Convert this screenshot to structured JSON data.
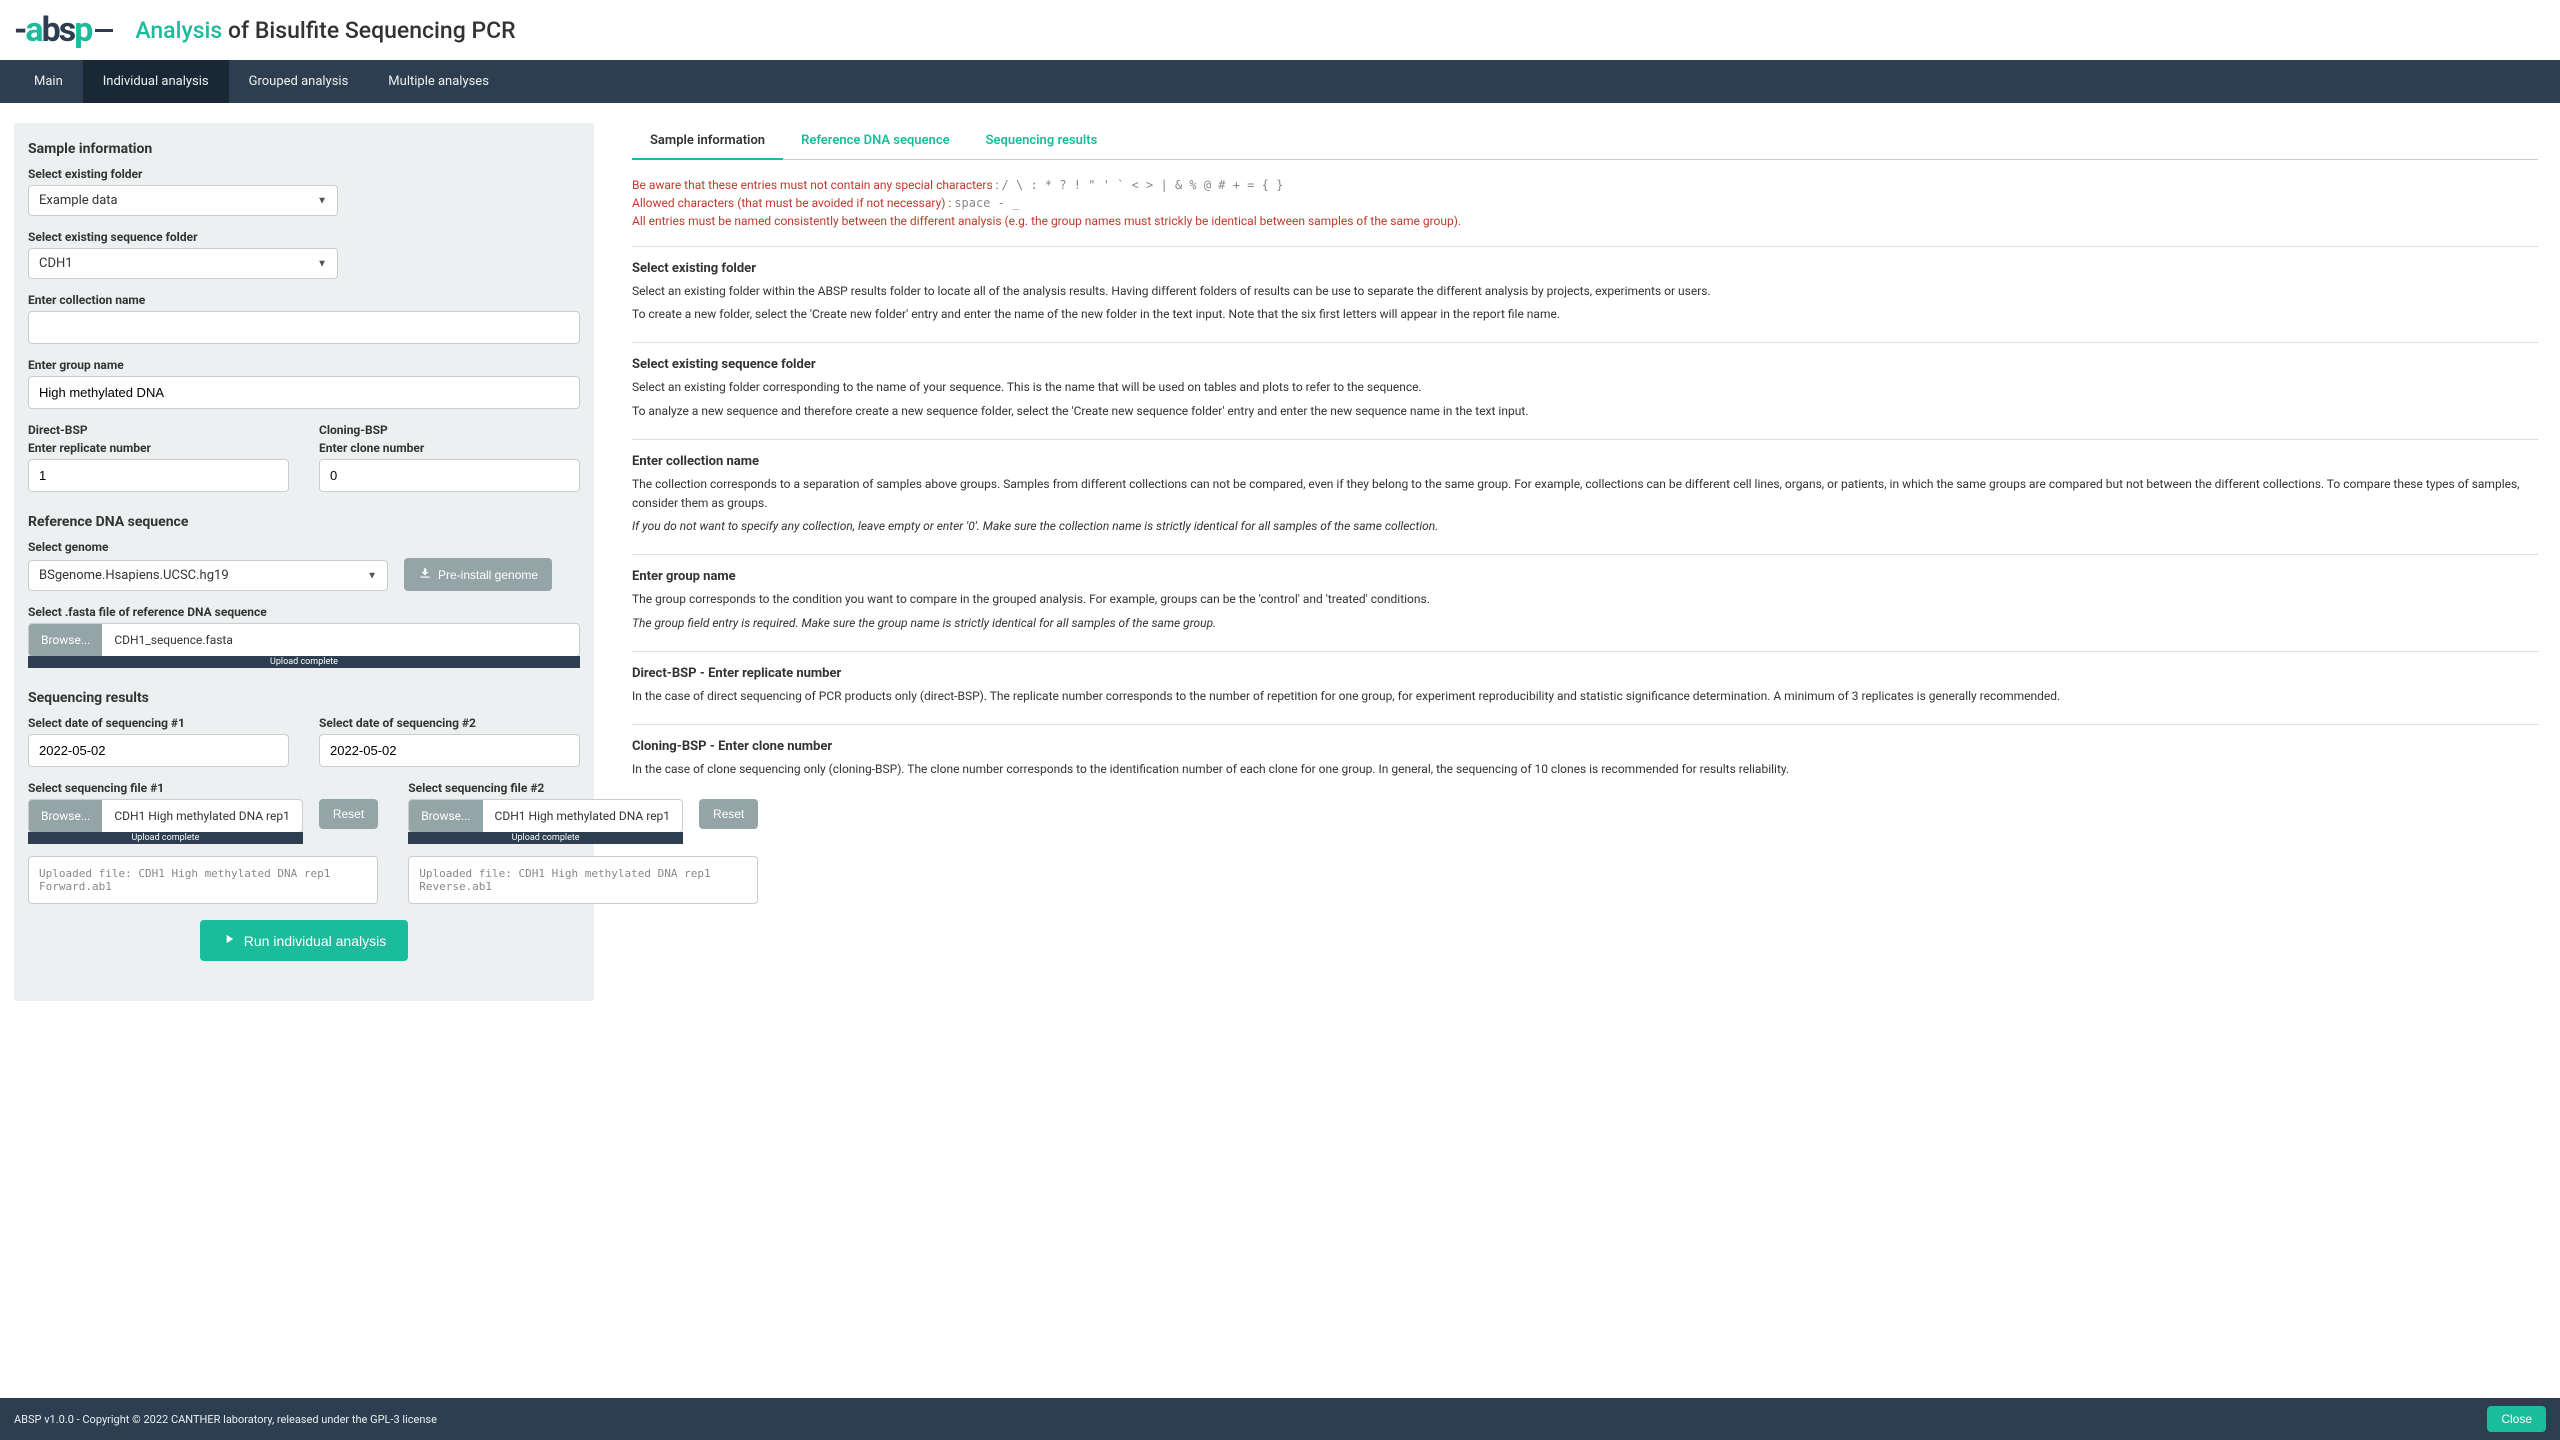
{
  "header": {
    "logo_plain_before": "-",
    "logo_accent1": "a",
    "logo_mid": "bs",
    "logo_accent2": "p",
    "title_accent": "Analysis",
    "title_rest": " of Bisulfite Sequencing PCR"
  },
  "nav": {
    "main": "Main",
    "individual": "Individual analysis",
    "grouped": "Grouped analysis",
    "multiple": "Multiple analyses"
  },
  "left": {
    "sample_info_title": "Sample information",
    "select_folder_label": "Select existing folder",
    "select_folder_value": "Example data",
    "select_seqfolder_label": "Select existing sequence folder",
    "select_seqfolder_value": "CDH1",
    "collection_label": "Enter collection name",
    "collection_value": "",
    "group_label": "Enter group name",
    "group_value": "High methylated DNA",
    "direct_bsp_label": "Direct-BSP",
    "replicate_label": "Enter replicate number",
    "replicate_value": "1",
    "cloning_bsp_label": "Cloning-BSP",
    "clone_label": "Enter clone number",
    "clone_value": "0",
    "ref_section_title": "Reference DNA sequence",
    "genome_label": "Select genome",
    "genome_value": "BSgenome.Hsapiens.UCSC.hg19",
    "preinstall_btn": "Pre-install genome",
    "fasta_label": "Select .fasta file of reference DNA sequence",
    "browse_label": "Browse...",
    "fasta_filename": "CDH1_sequence.fasta",
    "upload_complete": "Upload complete",
    "seq_results_title": "Sequencing results",
    "date1_label": "Select date of sequencing #1",
    "date1_value": "2022-05-02",
    "date2_label": "Select date of sequencing #2",
    "date2_value": "2022-05-02",
    "seqfile1_label": "Select sequencing file #1",
    "seqfile1_name": "CDH1 High methylated DNA rep1",
    "seqfile2_label": "Select sequencing file #2",
    "seqfile2_name": "CDH1 High methylated DNA rep1",
    "reset_btn": "Reset",
    "uploaded1": "Uploaded file: CDH1 High methylated DNA rep1 Forward.ab1",
    "uploaded2": "Uploaded file: CDH1 High methylated DNA rep1 Reverse.ab1",
    "run_btn": "Run individual analysis"
  },
  "right": {
    "tab_sample": "Sample information",
    "tab_ref": "Reference DNA sequence",
    "tab_seq": "Sequencing results",
    "warn1_text": "Be aware that these entries must not contain any special characters : ",
    "warn1_chars": "/ \\ : * ? ! \" ' ` < > | & % @ # + = { }",
    "warn2_text": "Allowed characters (that must be avoided if not necessary) : ",
    "warn2_chars": "space - _",
    "warn3": "All entries must be named consistently between the different analysis (e.g. the group names must strickly be identical between samples of the same group).",
    "s1_title": "Select existing folder",
    "s1_p1": "Select an existing folder within the ABSP results folder to locate all of the analysis results. Having different folders of results can be use to separate the different analysis by projects, experiments or users.",
    "s1_p2": "To create a new folder, select the 'Create new folder' entry and enter the name of the new folder in the text input. Note that the six first letters will appear in the report file name.",
    "s2_title": "Select existing sequence folder",
    "s2_p1": "Select an existing folder corresponding to the name of your sequence. This is the name that will be used on tables and plots to refer to the sequence.",
    "s2_p2": "To analyze a new sequence and therefore create a new sequence folder, select the 'Create new sequence folder' entry and enter the new sequence name in the text input.",
    "s3_title": "Enter collection name",
    "s3_p1": "The collection corresponds to a separation of samples above groups. Samples from different collections can not be compared, even if they belong to the same group. For example, collections can be different cell lines, organs, or patients, in which the same groups are compared but not between the different collections. To compare these types of samples, consider them as groups.",
    "s3_p2": "If you do not want to specify any collection, leave empty or enter '0'. Make sure the collection name is strictly identical for all samples of the same collection.",
    "s4_title": "Enter group name",
    "s4_p1": "The group corresponds to the condition you want to compare in the grouped analysis. For example, groups can be the 'control' and 'treated' conditions.",
    "s4_p2": "The group field entry is required. Make sure the group name is strictly identical for all samples of the same group.",
    "s5_title": "Direct-BSP - Enter replicate number",
    "s5_p1": "In the case of direct sequencing of PCR products only (direct-BSP). The replicate number corresponds to the number of repetition for one group, for experiment reproducibility and statistic significance determination. A minimum of 3 replicates is generally recommended.",
    "s6_title": "Cloning-BSP - Enter clone number",
    "s6_p1": "In the case of clone sequencing only (cloning-BSP). The clone number corresponds to the identification number of each clone for one group. In general, the sequencing of 10 clones is recommended for results reliability."
  },
  "footer": {
    "text": "ABSP v1.0.0 - Copyright © 2022 CANTHER laboratory, released under the GPL-3 license",
    "close": "Close"
  }
}
